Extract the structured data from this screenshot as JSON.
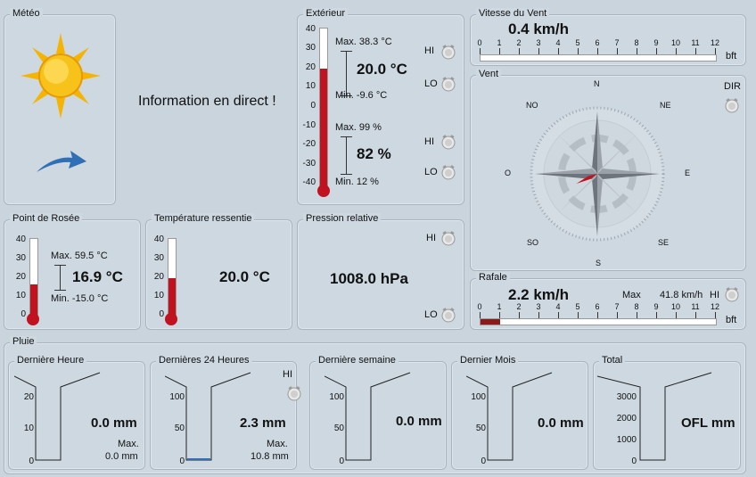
{
  "meteo": {
    "title": "Météo",
    "info": "Information en direct !"
  },
  "exterieur": {
    "title": "Extérieur",
    "scale": [
      "40",
      "30",
      "20",
      "10",
      "0",
      "-10",
      "-20",
      "-30",
      "-40"
    ],
    "fill_level": 0.75,
    "temp_max": "Max. 38.3 °C",
    "temp_value": "20.0 °C",
    "temp_min": "Min. -9.6 °C",
    "hum_max": "Max. 99 %",
    "hum_value": "82 %",
    "hum_min": "Min. 12 %",
    "hi": "HI",
    "lo": "LO"
  },
  "vitesse": {
    "title": "Vitesse du Vent",
    "value": "0.4 km/h",
    "ticks": [
      "0",
      "1",
      "2",
      "3",
      "4",
      "5",
      "6",
      "7",
      "8",
      "9",
      "10",
      "11",
      "12"
    ],
    "unit": "bft",
    "level": 0
  },
  "vent": {
    "title": "Vent",
    "dir": "DIR",
    "n": "N",
    "ne": "NE",
    "e": "E",
    "se": "SE",
    "s": "S",
    "so": "SO",
    "o": "O",
    "no": "NO",
    "needle_degrees": 245
  },
  "rosee": {
    "title": "Point de Rosée",
    "scale": [
      "40",
      "30",
      "20",
      "10",
      "0"
    ],
    "fill_level": 0.42,
    "max": "Max. 59.5 °C",
    "value": "16.9 °C",
    "min": "Min. -15.0 °C"
  },
  "ressentie": {
    "title": "Température ressentie",
    "scale": [
      "40",
      "30",
      "20",
      "10",
      "0"
    ],
    "fill_level": 0.5,
    "value": "20.0 °C"
  },
  "pression": {
    "title": "Pression relative",
    "value": "1008.0 hPa",
    "hi": "HI",
    "lo": "LO"
  },
  "rafale": {
    "title": "Rafale",
    "value": "2.2 km/h",
    "max_label": "Max",
    "max_value": "41.8 km/h",
    "hi": "HI",
    "ticks": [
      "0",
      "1",
      "2",
      "3",
      "4",
      "5",
      "6",
      "7",
      "8",
      "9",
      "10",
      "11",
      "12"
    ],
    "unit": "bft",
    "level": 1
  },
  "pluie": {
    "title": "Pluie",
    "heure": {
      "title": "Dernière Heure",
      "scale": [
        "20",
        "10",
        "0"
      ],
      "value": "0.0 mm",
      "max_label": "Max.",
      "max_value": "0.0 mm",
      "fill": 0
    },
    "jour": {
      "title": "Dernières 24 Heures",
      "scale": [
        "100",
        "50",
        "0"
      ],
      "value": "2.3 mm",
      "max_label": "Max.",
      "max_value": "10.8 mm",
      "hi": "HI",
      "fill": 0.023
    },
    "semaine": {
      "title": "Dernière semaine",
      "scale": [
        "100",
        "50",
        "0"
      ],
      "value": "0.0 mm",
      "fill": 0
    },
    "mois": {
      "title": "Dernier Mois",
      "scale": [
        "100",
        "50",
        "0"
      ],
      "value": "0.0 mm",
      "fill": 0
    },
    "total": {
      "title": "Total",
      "scale": [
        "3000",
        "2000",
        "1000",
        "0"
      ],
      "value": "OFL mm",
      "fill": 0
    }
  }
}
